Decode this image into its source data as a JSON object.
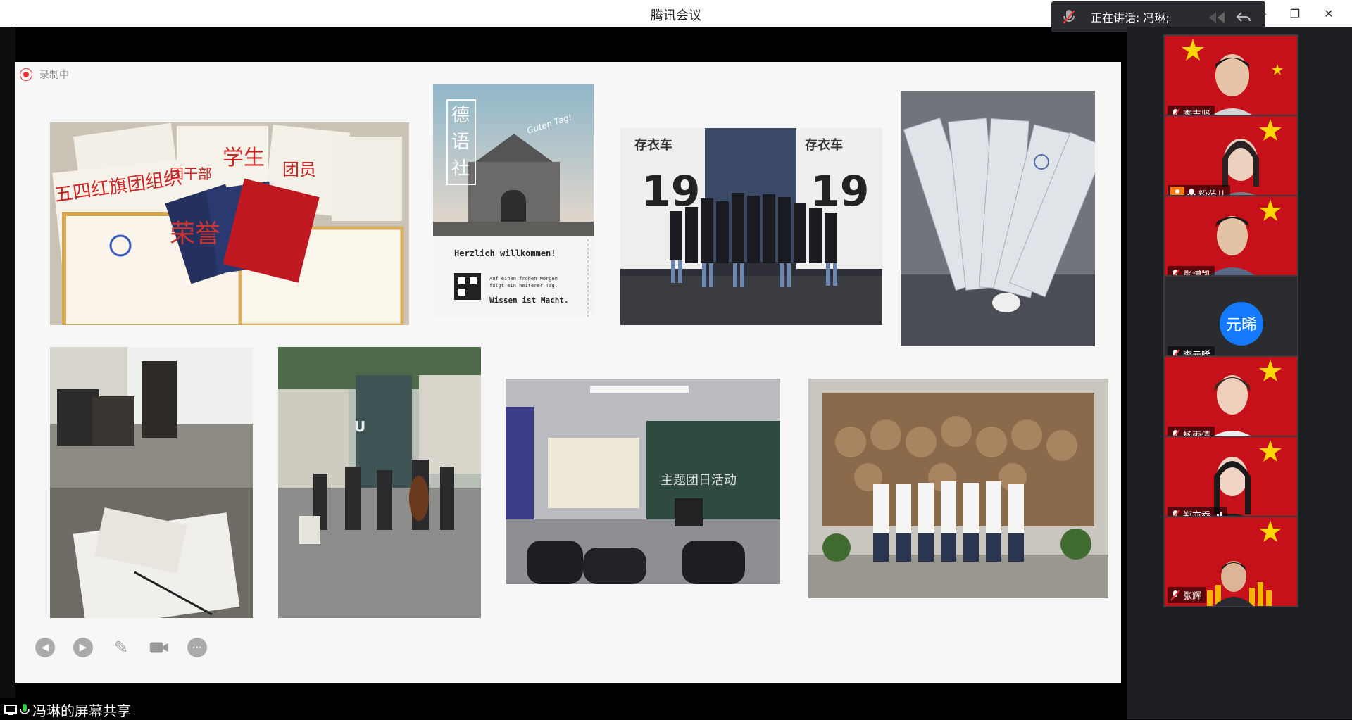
{
  "app": {
    "title": "腾讯会议"
  },
  "speaking": {
    "text": "正在讲话: 冯琳;"
  },
  "recording": {
    "label": "录制中"
  },
  "share": {
    "label": "冯琳的屏幕共享"
  },
  "slide": {
    "photos": [
      {
        "id": "certificates",
        "text_main": "荣誉",
        "text_a": "五四红旗团组织",
        "text_b": "学生",
        "text_c": "团干部",
        "text_d": "团员"
      },
      {
        "id": "german-club-poster",
        "title": "德语社",
        "top_text": "Guten Tag!",
        "heading": "Herzlich willkommen!",
        "line1": "Auf einen frohen Morgen",
        "line2": "folgt ein heiterer Tag.",
        "motto": "Wissen ist Macht."
      },
      {
        "id": "truck-group",
        "truck_text": "存衣车",
        "number": "19"
      },
      {
        "id": "cards-fan"
      },
      {
        "id": "classroom-study"
      },
      {
        "id": "street-music",
        "sign": "U"
      },
      {
        "id": "lecture-room",
        "board_text": "主题团日活动"
      },
      {
        "id": "museum-statues"
      }
    ]
  },
  "participants": [
    {
      "name": "李志坚",
      "mic": "muted",
      "video": true
    },
    {
      "name": "粉范儿",
      "mic": "on",
      "video": true,
      "host": true
    },
    {
      "name": "张博凯",
      "mic": "muted",
      "video": true
    },
    {
      "name": "李元晞",
      "mic": "muted",
      "video": false,
      "avatar_text": "元晞"
    },
    {
      "name": "杨雨倩",
      "mic": "muted",
      "video": true
    },
    {
      "name": "郑亦乔",
      "mic": "muted",
      "video": true,
      "signal": true
    },
    {
      "name": "张辉",
      "mic": "muted",
      "video": true
    }
  ],
  "colors": {
    "accent_blue": "#1479ff",
    "flag_red": "#c6101a",
    "star_yellow": "#ffd700",
    "panel": "#1e1f22"
  }
}
